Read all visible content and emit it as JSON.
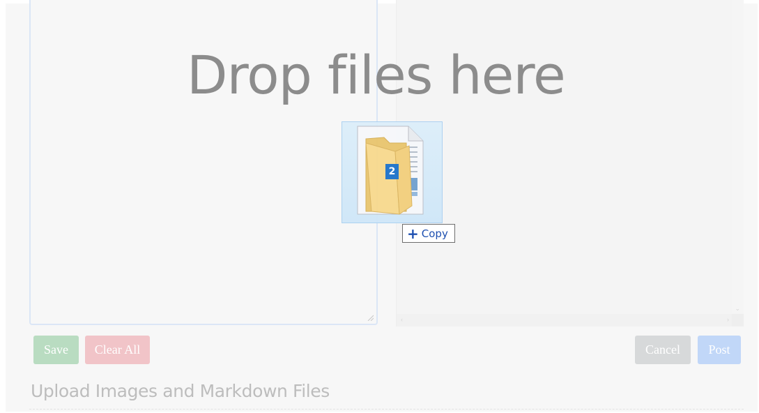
{
  "editor": {},
  "toolbar": {
    "save_label": "Save",
    "clear_label": "Clear All",
    "cancel_label": "Cancel",
    "post_label": "Post"
  },
  "upload": {
    "heading": "Upload Images and Markdown Files"
  },
  "drop_overlay": {
    "text": "Drop files here",
    "drag_count": "2",
    "effect_label": "Copy",
    "effect_icon": "plus-icon"
  },
  "colors": {
    "save": "#b9dcc1",
    "clear": "#f1c4c8",
    "cancel": "#d7d9da",
    "post": "#c1d7f8",
    "drop_text": "#8c8c8c",
    "badge": "#1c72c9"
  }
}
